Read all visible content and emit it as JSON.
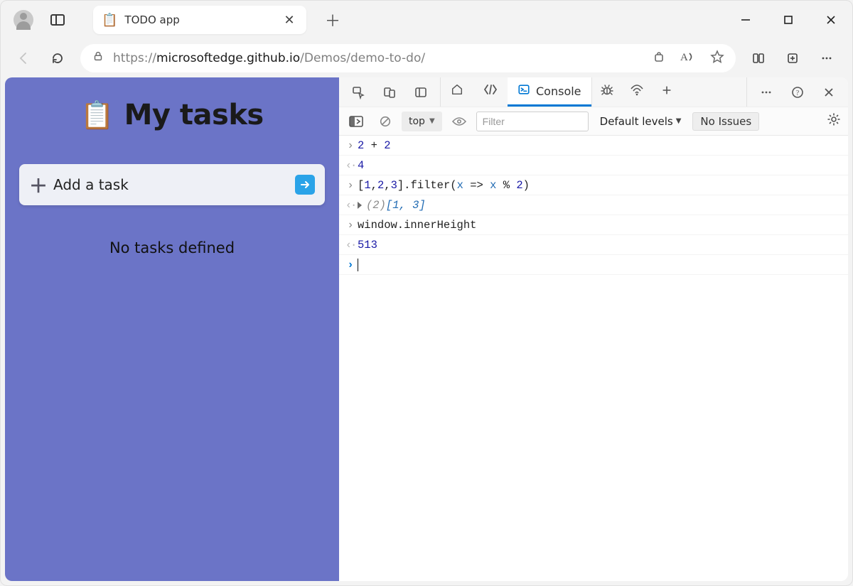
{
  "tab": {
    "favicon": "📋",
    "title": "TODO app"
  },
  "url": {
    "protocol": "https://",
    "host": "microsoftedge.github.io",
    "path_muted": "/Demos/demo-to-do/"
  },
  "app": {
    "header_emoji": "📋",
    "header_title": "My tasks",
    "add_task_label": "Add a task",
    "no_tasks_label": "No tasks defined"
  },
  "devtools": {
    "console_tab_label": "Console",
    "context_dropdown": "top",
    "filter_placeholder": "Filter",
    "levels_label": "Default levels",
    "issues_label": "No Issues",
    "log": [
      {
        "kind": "in",
        "seg": [
          "2",
          " + ",
          "2"
        ],
        "cls": [
          "tok-num",
          "",
          "tok-num"
        ]
      },
      {
        "kind": "out",
        "seg": [
          "4"
        ],
        "cls": [
          "tok-num"
        ]
      },
      {
        "kind": "in",
        "seg": [
          "[",
          "1",
          ",",
          "2",
          ",",
          "3",
          "].filter(",
          "x",
          " => ",
          "x",
          " % ",
          "2",
          ")"
        ],
        "cls": [
          "",
          "tok-num",
          "",
          "tok-num",
          "",
          "tok-num",
          "",
          "tok-arr",
          "",
          "tok-arr",
          "",
          "tok-num",
          ""
        ]
      },
      {
        "kind": "out_expand",
        "len": "(2)",
        "val": "[1, 3]"
      },
      {
        "kind": "in",
        "seg": [
          "window.innerHeight"
        ],
        "cls": [
          ""
        ]
      },
      {
        "kind": "out",
        "seg": [
          "513"
        ],
        "cls": [
          "tok-num"
        ]
      }
    ]
  }
}
